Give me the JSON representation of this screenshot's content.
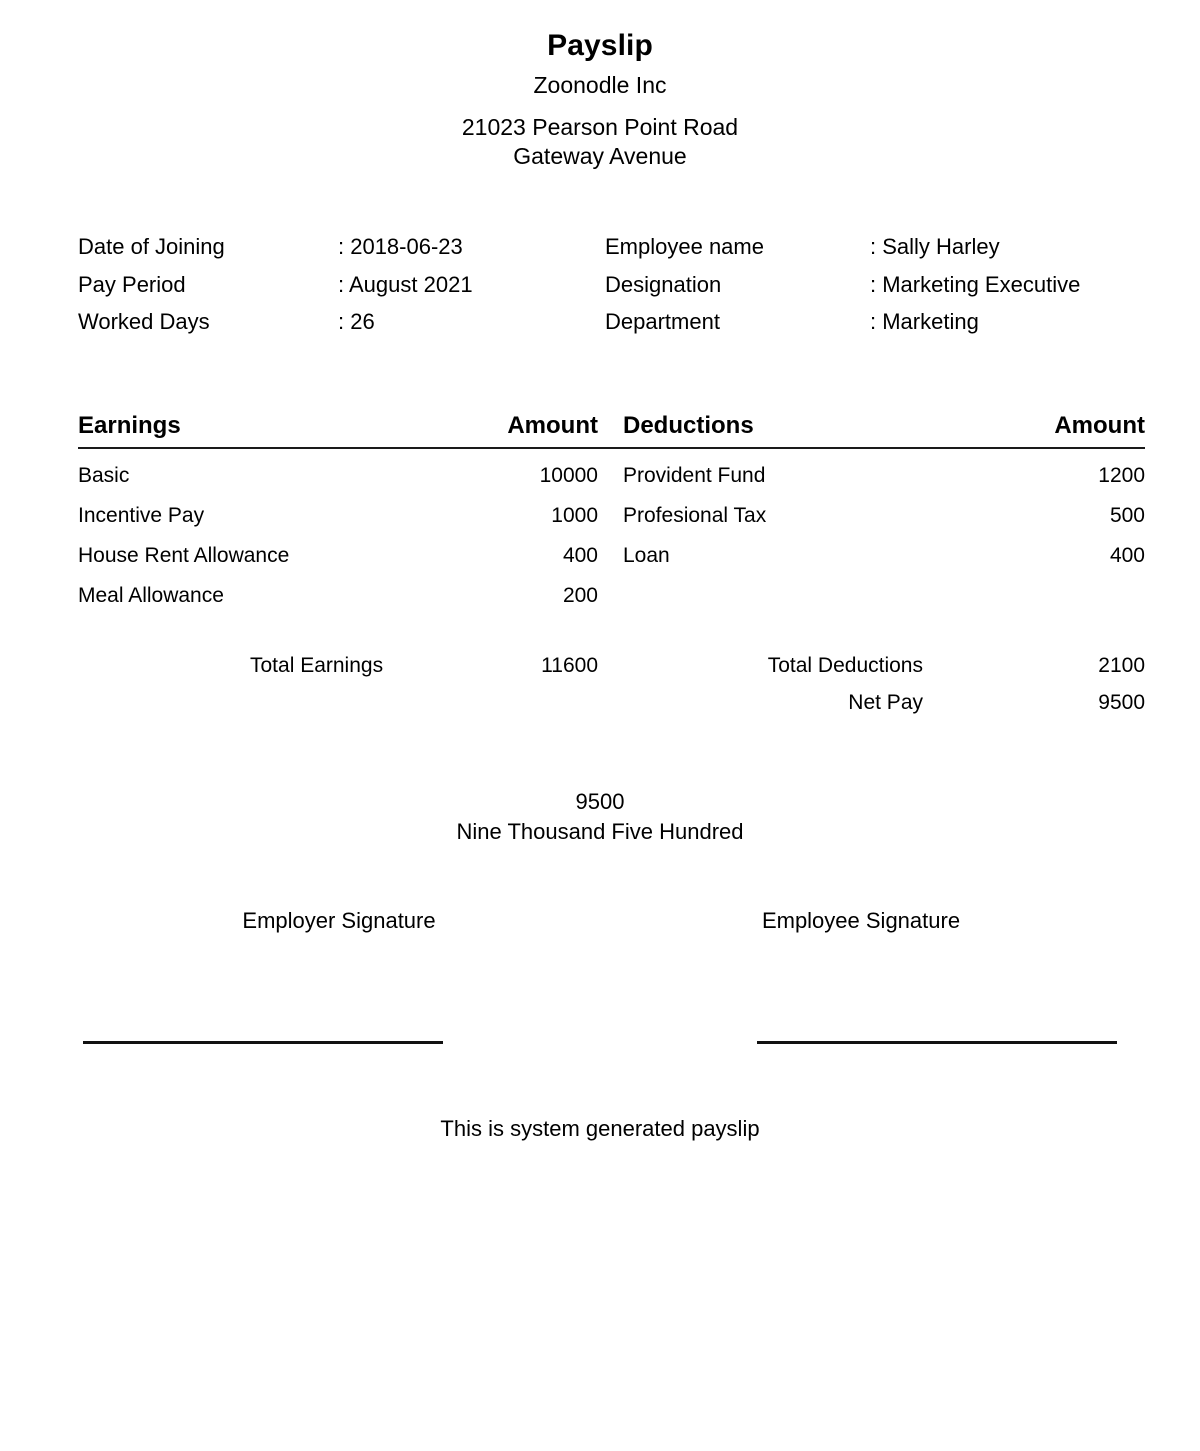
{
  "header": {
    "title": "Payslip",
    "company_name": "Zoonodle Inc",
    "address_line_1": "21023 Pearson Point Road",
    "address_line_2": "Gateway Avenue"
  },
  "details": {
    "left": [
      {
        "label": "Date of Joining",
        "value": ": 2018-06-23"
      },
      {
        "label": "Pay Period",
        "value": ": August 2021"
      },
      {
        "label": "Worked Days",
        "value": ": 26"
      }
    ],
    "right": [
      {
        "label": "Employee name",
        "value": ": Sally Harley"
      },
      {
        "label": "Designation",
        "value": ": Marketing Executive"
      },
      {
        "label": "Department",
        "value": ": Marketing"
      }
    ]
  },
  "table": {
    "earnings_header": "Earnings",
    "earnings_amount_header": "Amount",
    "deductions_header": "Deductions",
    "deductions_amount_header": "Amount",
    "earnings": [
      {
        "name": "Basic",
        "amount": "10000"
      },
      {
        "name": "Incentive Pay",
        "amount": "1000"
      },
      {
        "name": "House Rent Allowance",
        "amount": "400"
      },
      {
        "name": "Meal Allowance",
        "amount": "200"
      }
    ],
    "deductions": [
      {
        "name": "Provident Fund",
        "amount": "1200"
      },
      {
        "name": "Profesional Tax",
        "amount": "500"
      },
      {
        "name": "Loan",
        "amount": "400"
      }
    ]
  },
  "totals": {
    "total_earnings_label": "Total Earnings",
    "total_earnings_amount": "11600",
    "total_deductions_label": "Total Deductions",
    "total_deductions_amount": "2100",
    "net_pay_label": "Net Pay",
    "net_pay_amount": "9500"
  },
  "net_pay_summary": {
    "amount": "9500",
    "amount_in_words": "Nine Thousand Five Hundred"
  },
  "signatures": {
    "employer_label": "Employer Signature",
    "employee_label": "Employee Signature"
  },
  "footer": {
    "note": "This is system generated payslip"
  }
}
